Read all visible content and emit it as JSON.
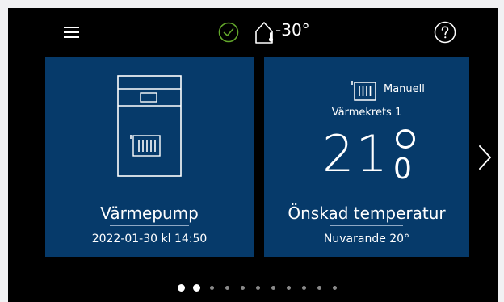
{
  "status": {
    "outdoor_temperature": "-30°",
    "system_ok_icon": "check-circle-icon",
    "house_thermometer_icon": "house-thermometer-icon",
    "menu_icon": "hamburger-menu-icon",
    "help_icon": "help-circle-icon"
  },
  "cards": [
    {
      "title": "Värmepump",
      "subtitle": "2022-01-30 kl 14:50",
      "icon": "heat-pump-unit-icon"
    },
    {
      "mode_label": "Manuell",
      "mode_icon": "radiator-icon",
      "circuit": "Värmekrets 1",
      "temperature_integer": "21",
      "temperature_decimal": "0",
      "title": "Önskad temperatur",
      "subtitle": "Nuvarande 20°"
    }
  ],
  "pagination": {
    "total": 11,
    "active_index": 1
  },
  "colors": {
    "card_background": "#063a6a",
    "screen_background": "#000000",
    "status_ok": "#63a82b",
    "text": "#ffffff"
  }
}
